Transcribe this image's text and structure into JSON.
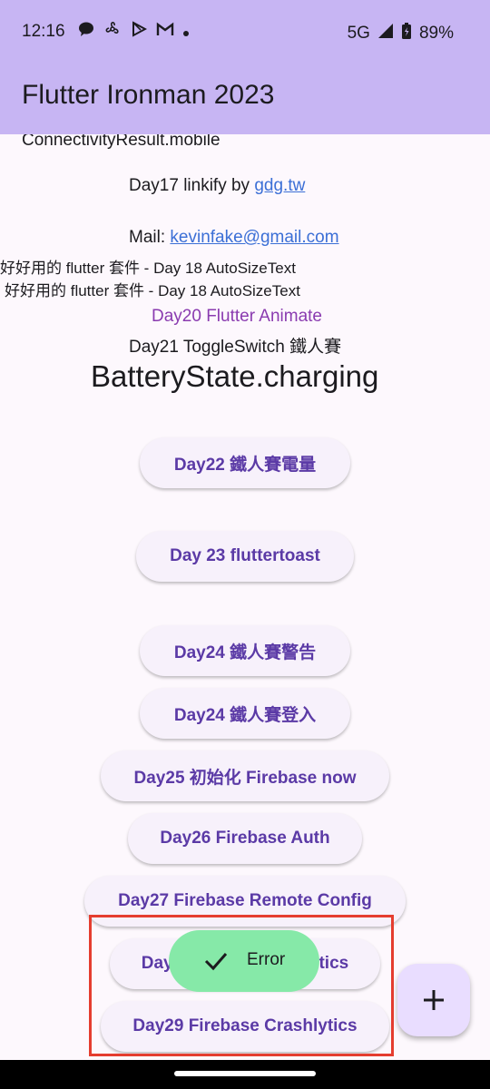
{
  "status_bar": {
    "time": "12:16",
    "left_icons": [
      "message-icon",
      "fan-icon",
      "play-store-icon",
      "gmail-icon",
      "dot-icon"
    ],
    "network": "5G",
    "battery": "89%"
  },
  "app_bar": {
    "title": "Flutter Ironman 2023"
  },
  "main": {
    "connectivity": "ConnectivityResult.mobile",
    "linkify_prefix": "Day17 linkify by ",
    "linkify_link": "gdg.tw",
    "mail_prefix": "Mail: ",
    "mail_link": "kevinfake@gmail.com",
    "autosize_line1": "好好用的 flutter 套件 - Day 18 AutoSizeText",
    "autosize_line2": "好好用的 flutter 套件 - Day 18 AutoSizeText",
    "animate": "Day20 Flutter Animate",
    "toggle": "Day21 ToggleSwitch 鐵人賽",
    "battery_state": "BatteryState.charging",
    "buttons": [
      "Day22 鐵人賽電量",
      "Day 23 fluttertoast",
      "Day24 鐵人賽警告",
      "Day24 鐵人賽登入",
      "Day25 初始化 Firebase now",
      "Day26 Firebase Auth",
      "Day27 Firebase Remote Config",
      "Day28 Firebase Analytics",
      "Day29 Firebase Crashlytics"
    ]
  },
  "toast": {
    "label": "Error"
  },
  "colors": {
    "app_bar": "#c7b5f3",
    "button_text": "#5b3aa6",
    "toast_bg": "#86e9a8",
    "highlight": "#e53d2f"
  }
}
